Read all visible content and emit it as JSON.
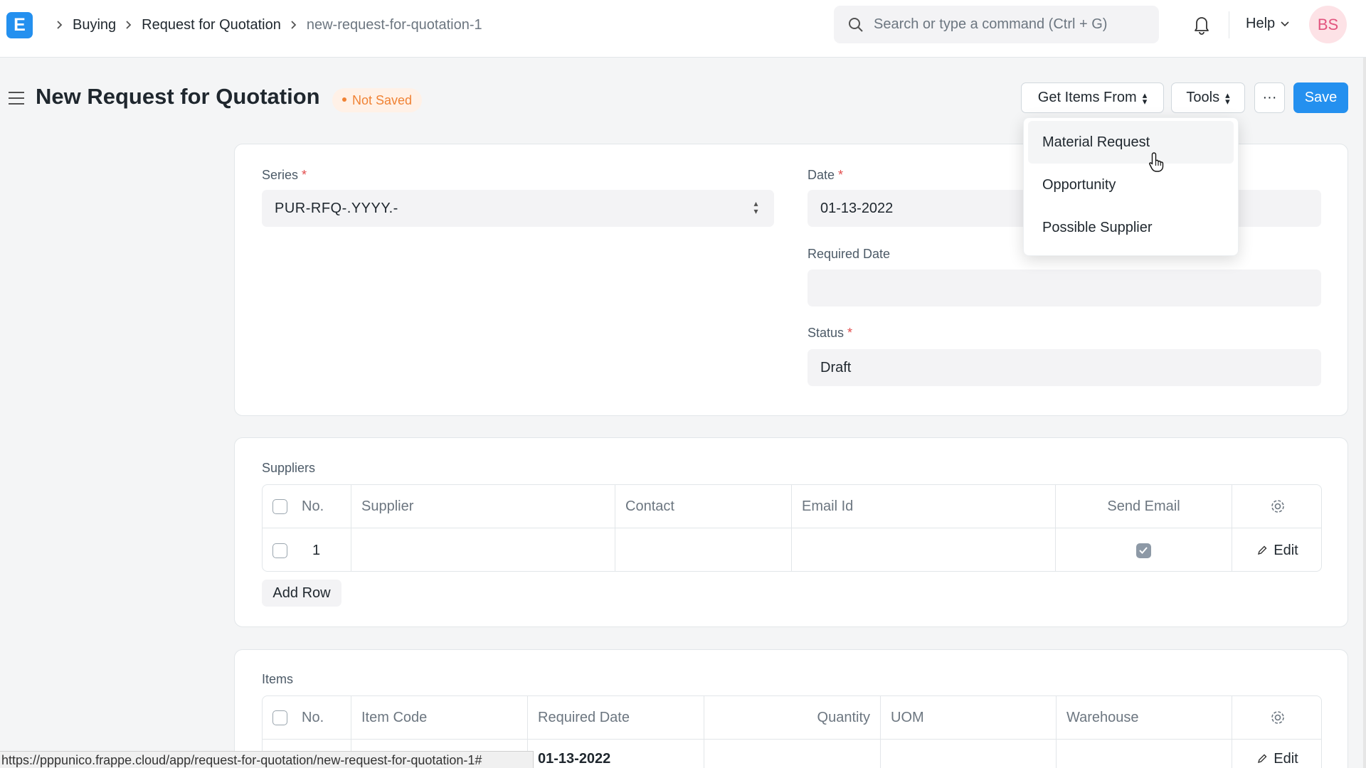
{
  "app": {
    "logo_letter": "E"
  },
  "breadcrumbs": [
    "Buying",
    "Request for Quotation",
    "new-request-for-quotation-1"
  ],
  "search": {
    "placeholder": "Search or type a command (Ctrl + G)"
  },
  "nav": {
    "help_label": "Help",
    "avatar_initials": "BS"
  },
  "page": {
    "title": "New Request for Quotation",
    "status_indicator": "Not Saved",
    "actions": {
      "get_items_from": "Get Items From",
      "tools": "Tools",
      "more": "···",
      "save": "Save"
    }
  },
  "dropdown": {
    "items": [
      "Material Request",
      "Opportunity",
      "Possible Supplier"
    ],
    "hovered_index": 0
  },
  "form": {
    "series_label": "Series",
    "series_value": "PUR-RFQ-.YYYY.-",
    "date_label": "Date",
    "date_value": "01-13-2022",
    "required_date_label": "Required Date",
    "required_date_value": "",
    "status_label": "Status",
    "status_value": "Draft"
  },
  "suppliers": {
    "title": "Suppliers",
    "columns": [
      "No.",
      "Supplier",
      "Contact",
      "Email Id",
      "Send Email"
    ],
    "rows": [
      {
        "no": "1",
        "supplier": "",
        "contact": "",
        "email_id": "",
        "send_email": true,
        "edit_label": "Edit"
      }
    ],
    "add_row_label": "Add Row"
  },
  "items": {
    "title": "Items",
    "columns": [
      "No.",
      "Item Code",
      "Required Date",
      "Quantity",
      "UOM",
      "Warehouse"
    ],
    "rows": [
      {
        "required_date": "01-13-2022",
        "edit_label": "Edit"
      }
    ]
  },
  "statusbar": {
    "url": "https://pppunico.frappe.cloud/app/request-for-quotation/new-request-for-quotation-1#"
  },
  "colors": {
    "primary": "#2490ef",
    "indicator_orange": "#f08234",
    "avatar_bg": "#fde2e6",
    "avatar_fg": "#e2547e"
  }
}
